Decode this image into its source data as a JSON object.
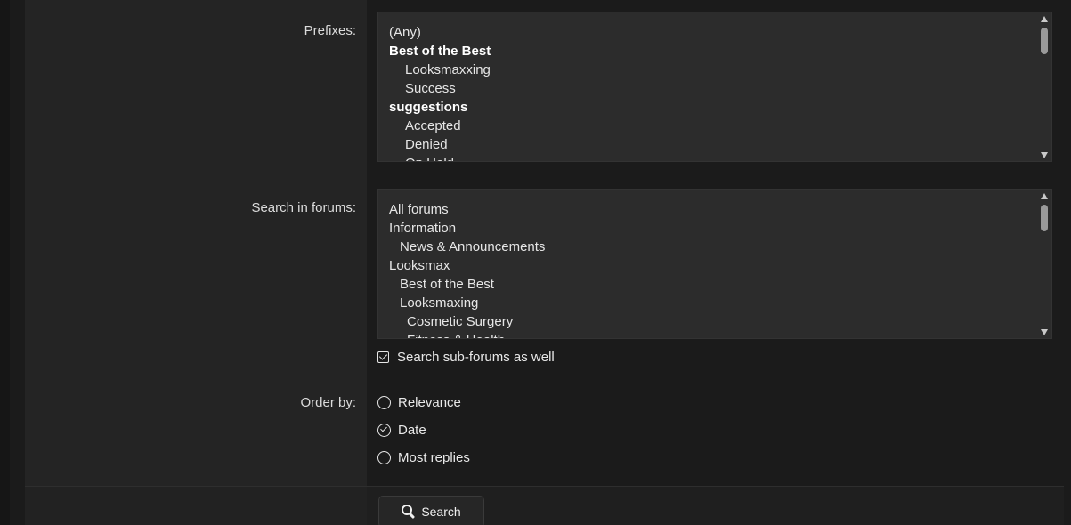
{
  "prefixes": {
    "label": "Prefixes:",
    "options": [
      {
        "text": "(Any)",
        "kind": "plain"
      },
      {
        "text": "Best of the Best",
        "kind": "group"
      },
      {
        "text": "Looksmaxxing",
        "kind": "child"
      },
      {
        "text": "Success",
        "kind": "child"
      },
      {
        "text": "suggestions",
        "kind": "group"
      },
      {
        "text": "Accepted",
        "kind": "child"
      },
      {
        "text": "Denied",
        "kind": "child"
      },
      {
        "text": "On Hold",
        "kind": "child"
      }
    ]
  },
  "forums": {
    "label": "Search in forums:",
    "options": [
      {
        "text": "All forums",
        "kind": "plain"
      },
      {
        "text": "Information",
        "kind": "plain"
      },
      {
        "text": "News & Announcements",
        "kind": "sub"
      },
      {
        "text": "Looksmax",
        "kind": "plain"
      },
      {
        "text": "Best of the Best",
        "kind": "sub"
      },
      {
        "text": "Looksmaxing",
        "kind": "sub"
      },
      {
        "text": "Cosmetic Surgery",
        "kind": "subsub"
      },
      {
        "text": "Fitness & Health",
        "kind": "subsub"
      }
    ],
    "subforums_checkbox": {
      "label": "Search sub-forums as well",
      "checked": true
    }
  },
  "order_by": {
    "label": "Order by:",
    "options": [
      {
        "text": "Relevance",
        "checked": false
      },
      {
        "text": "Date",
        "checked": true
      },
      {
        "text": "Most replies",
        "checked": false
      }
    ]
  },
  "actions": {
    "search_label": "Search"
  }
}
